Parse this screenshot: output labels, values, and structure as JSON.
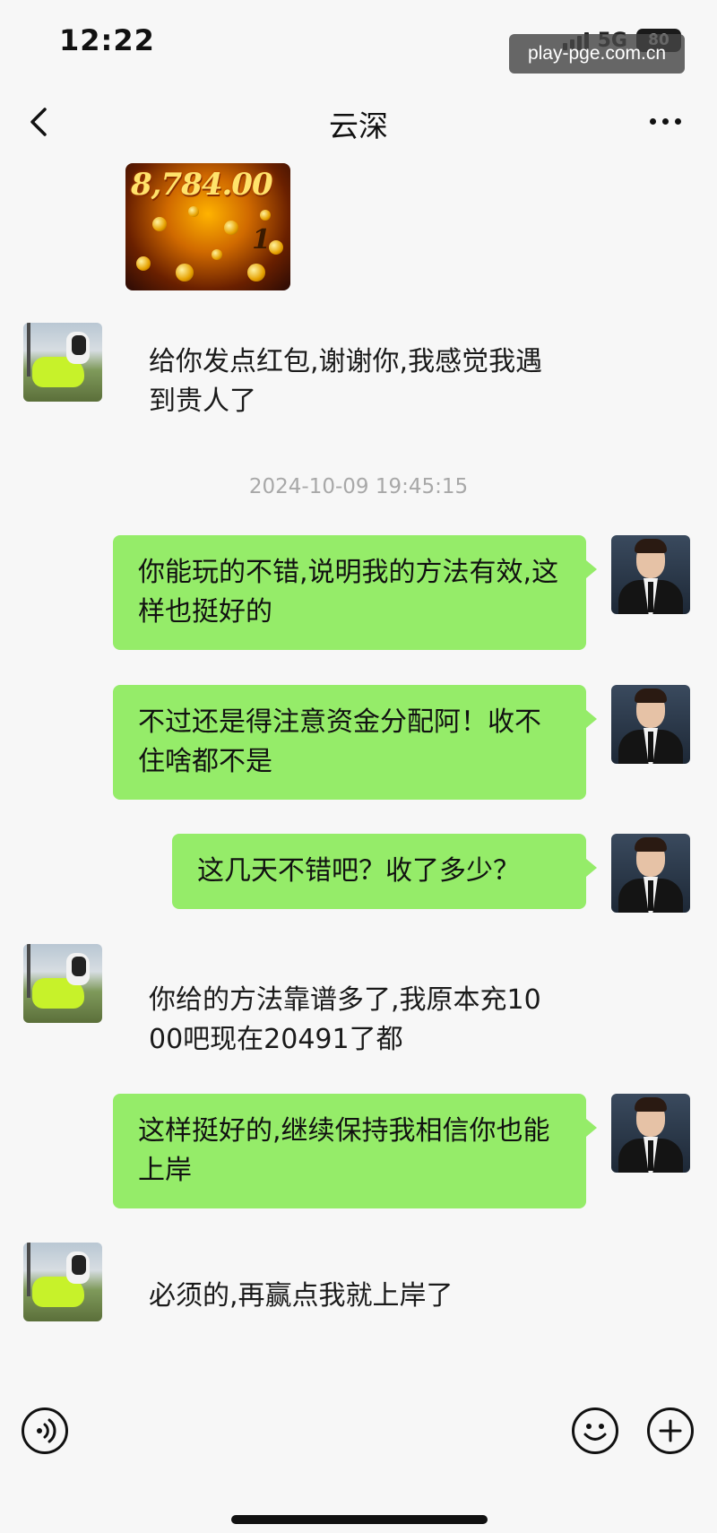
{
  "status_bar": {
    "time": "12:22",
    "network": "5G",
    "battery": "80",
    "watermark": "play-pge.com.cn"
  },
  "header": {
    "title": "云深",
    "back_icon": "chevron-left-icon",
    "more_icon": "more-dots-icon"
  },
  "shared_image": {
    "amount_text": "8,784.00",
    "digit": "1"
  },
  "messages": [
    {
      "side": "in",
      "text": "给你发点红包,谢谢你,我感觉我遇到贵人了"
    },
    {
      "side": "out",
      "text": "你能玩的不错,说明我的方法有效,这样也挺好的"
    },
    {
      "side": "out",
      "text": "不过还是得注意资金分配阿！收不住啥都不是"
    },
    {
      "side": "out",
      "text": "这几天不错吧？收了多少？"
    },
    {
      "side": "in",
      "text": "你给的方法靠谱多了,我原本充1000吧现在20491了都"
    },
    {
      "side": "out",
      "text": "这样挺好的,继续保持我相信你也能上岸"
    },
    {
      "side": "in",
      "text": "必须的,再赢点我就上岸了"
    }
  ],
  "timestamp": "2024-10-09 19:45:15",
  "bottom_bar": {
    "voice_icon": "voice-input-icon",
    "emoji_icon": "emoji-icon",
    "plus_icon": "plus-icon"
  },
  "colors": {
    "outgoing_bubble": "#95ec69",
    "background": "#f7f7f7",
    "timestamp": "#a8a8a8"
  }
}
